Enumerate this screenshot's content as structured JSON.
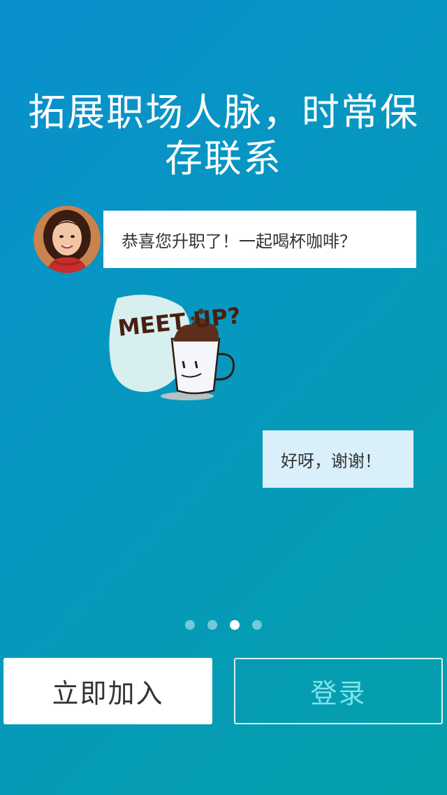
{
  "headline": {
    "line1": "拓展职场人脉，时常保",
    "line2": "存联系"
  },
  "chat": {
    "incoming_message": "恭喜您升职了！一起喝杯咖啡？",
    "sticker_text": "MEET UP?",
    "outgoing_message": "好呀，谢谢！"
  },
  "pagination": {
    "total": 4,
    "active_index": 2
  },
  "buttons": {
    "join_label": "立即加入",
    "login_label": "登录"
  },
  "colors": {
    "background_start": "#0a8fce",
    "background_end": "#04a0ab",
    "incoming_bubble": "#ffffff",
    "outgoing_bubble": "#d9f0fb",
    "login_text": "#7fe3e8"
  },
  "icons": {
    "avatar": "user-avatar-photo",
    "sticker": "coffee-cup-meet-up-sticker"
  }
}
